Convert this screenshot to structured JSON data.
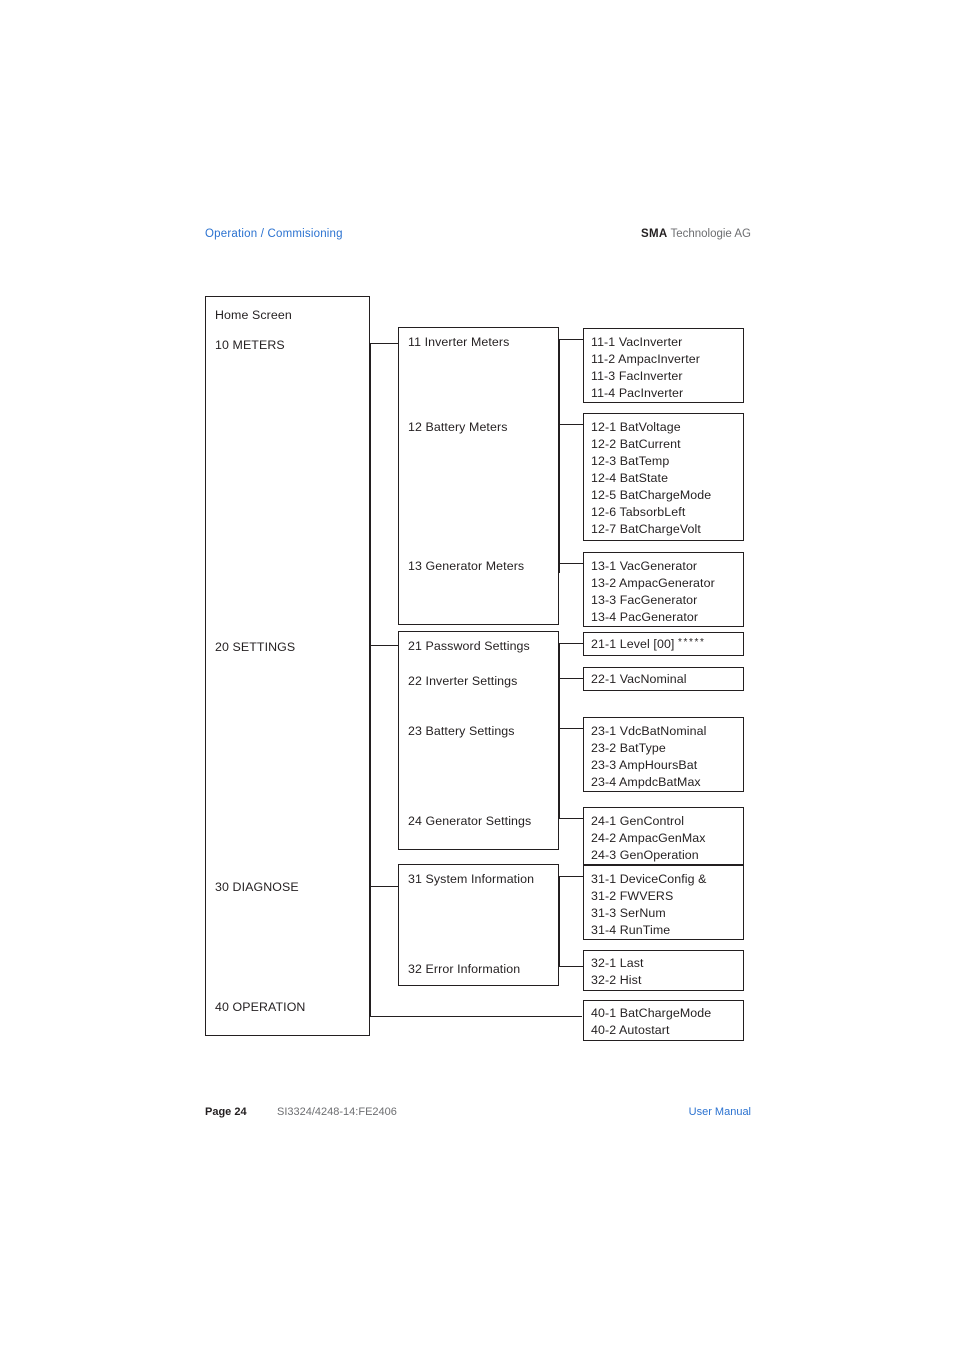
{
  "header": {
    "breadcrumb": "Operation / Commisioning",
    "brand_bold": "SMA",
    "brand_rest": " Technologie AG",
    "link_color": "#2b72d0"
  },
  "footer": {
    "page_label": "Page 24",
    "doc_code": "SI3324/4248-14:FE2406",
    "manual_label": "User Manual"
  },
  "diagram": {
    "root": {
      "title": "Home Screen",
      "items": [
        {
          "label": "10 METERS"
        },
        {
          "label": "20 SETTINGS"
        },
        {
          "label": "30 DIAGNOSE"
        },
        {
          "label": "40 OPERATION"
        }
      ]
    },
    "level2": {
      "meters": [
        {
          "label": "11 Inverter Meters"
        },
        {
          "label": "12 Battery Meters"
        },
        {
          "label": "13 Generator Meters"
        }
      ],
      "settings": [
        {
          "label": "21 Password Settings"
        },
        {
          "label": "22 Inverter Settings"
        },
        {
          "label": "23 Battery Settings"
        },
        {
          "label": "24 Generator Settings"
        }
      ],
      "diagnose": [
        {
          "label": "31 System Information"
        },
        {
          "label": "32 Error Information"
        }
      ]
    },
    "level3": {
      "inverter_meters": [
        "11-1 VacInverter",
        "11-2 AmpacInverter",
        "11-3 FacInverter",
        "11-4 PacInverter"
      ],
      "battery_meters": [
        "12-1 BatVoltage",
        "12-2 BatCurrent",
        "12-3 BatTemp",
        "12-4 BatState",
        "12-5 BatChargeMode",
        "12-6 TabsorbLeft",
        "12-7 BatChargeVolt"
      ],
      "generator_meters": [
        "13-1 VacGenerator",
        "13-2 AmpacGenerator",
        "13-3 FacGenerator",
        "13-4 PacGenerator"
      ],
      "password_settings_prefix": "21-1 Level [00] ",
      "password_settings_stars": "*****",
      "inverter_settings": [
        "22-1 VacNominal"
      ],
      "battery_settings": [
        "23-1 VdcBatNominal",
        "23-2 BatType",
        "23-3 AmpHoursBat",
        "23-4 AmpdcBatMax"
      ],
      "generator_settings": [
        "24-1 GenControl",
        "24-2 AmpacGenMax",
        "24-3 GenOperation"
      ],
      "system_information": [
        "31-1 DeviceConfig &",
        "31-2 FWVERS",
        "31-3 SerNum",
        "31-4 RunTime"
      ],
      "error_information": [
        "32-1 Last",
        "32-2 Hist"
      ],
      "operation": [
        "40-1 BatChargeMode",
        "40-2 Autostart"
      ]
    }
  }
}
